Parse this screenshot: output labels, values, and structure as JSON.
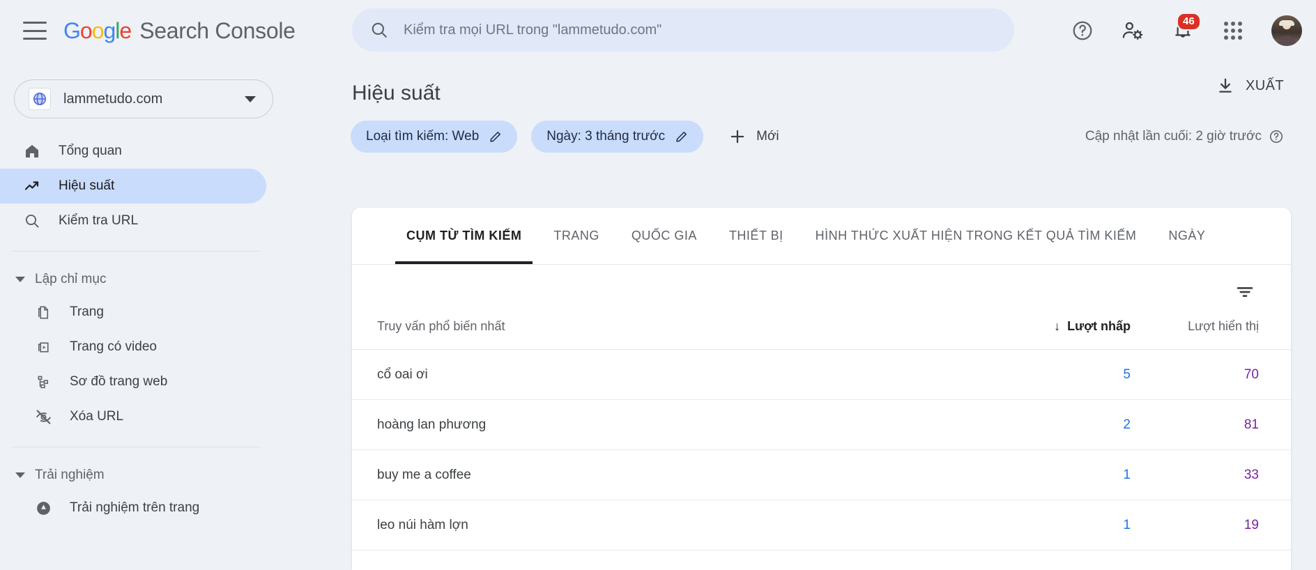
{
  "app": {
    "brand_google": "Google",
    "brand_product": "Search Console",
    "menu_icon": "hamburger-icon"
  },
  "search": {
    "placeholder": "Kiểm tra mọi URL trong \"lammetudo.com\"",
    "value": "",
    "icon": "search-icon"
  },
  "topbar_icons": {
    "help": "help-icon",
    "account_settings": "person-gear-icon",
    "notifications": "bell-icon",
    "notifications_badge": "46",
    "apps": "apps-grid-icon",
    "avatar": "user-avatar"
  },
  "sidebar": {
    "property": {
      "name": "lammetudo.com",
      "icon": "globe-icon",
      "caret": "chevron-down-icon"
    },
    "items": [
      {
        "label": "Tổng quan",
        "icon": "home-icon",
        "active": false
      },
      {
        "label": "Hiệu suất",
        "icon": "trending-up-icon",
        "active": true
      },
      {
        "label": "Kiểm tra URL",
        "icon": "search-icon",
        "active": false
      }
    ],
    "groups": [
      {
        "label": "Lập chỉ mục",
        "items": [
          {
            "label": "Trang",
            "icon": "pages-icon"
          },
          {
            "label": "Trang có video",
            "icon": "video-pages-icon"
          },
          {
            "label": "Sơ đồ trang web",
            "icon": "sitemap-icon"
          },
          {
            "label": "Xóa URL",
            "icon": "eye-off-icon"
          }
        ]
      },
      {
        "label": "Trải nghiệm",
        "items": [
          {
            "label": "Trải nghiệm trên trang",
            "icon": "page-experience-icon"
          }
        ]
      }
    ]
  },
  "page": {
    "title": "Hiệu suất",
    "export_label": "XUẤT",
    "export_icon": "download-icon"
  },
  "filters": {
    "chips": [
      {
        "label": "Loại tìm kiếm: Web",
        "icon": "pencil-icon"
      },
      {
        "label": "Ngày: 3 tháng trước",
        "icon": "pencil-icon"
      }
    ],
    "new_label": "Mới",
    "new_icon": "plus-icon",
    "last_updated": "Cập nhật lần cuối: 2 giờ trước",
    "last_updated_icon": "help-icon"
  },
  "card": {
    "tabs": [
      {
        "label": "CỤM TỪ TÌM KIẾM",
        "active": true
      },
      {
        "label": "TRANG",
        "active": false
      },
      {
        "label": "QUỐC GIA",
        "active": false
      },
      {
        "label": "THIẾT BỊ",
        "active": false
      },
      {
        "label": "HÌNH THỨC XUẤT HIỆN TRONG KẾT QUẢ TÌM KIẾM",
        "active": false
      },
      {
        "label": "NGÀY",
        "active": false
      }
    ],
    "toolbar": {
      "filter_icon": "filter-list-icon"
    },
    "table": {
      "columns": {
        "query": "Truy vấn phổ biến nhất",
        "clicks": "Lượt nhấp",
        "impressions": "Lượt hiển thị",
        "sort_indicator": "↓",
        "sorted_by": "clicks"
      },
      "rows": [
        {
          "query": "cổ oai ơi",
          "clicks": "5",
          "impressions": "70"
        },
        {
          "query": "hoàng lan phương",
          "clicks": "2",
          "impressions": "81"
        },
        {
          "query": "buy me a coffee",
          "clicks": "1",
          "impressions": "33"
        },
        {
          "query": "leo núi hàm lợn",
          "clicks": "1",
          "impressions": "19"
        }
      ]
    }
  },
  "colors": {
    "page_bg": "#eef1f6",
    "card_bg": "#ffffff",
    "accent_blue": "#1a73e8",
    "chip_bg": "#c9dcfc",
    "clicks": "#1a73e8",
    "impressions": "#7b1fa2",
    "badge_red": "#d93025",
    "active_nav": "#c9dcfc"
  }
}
